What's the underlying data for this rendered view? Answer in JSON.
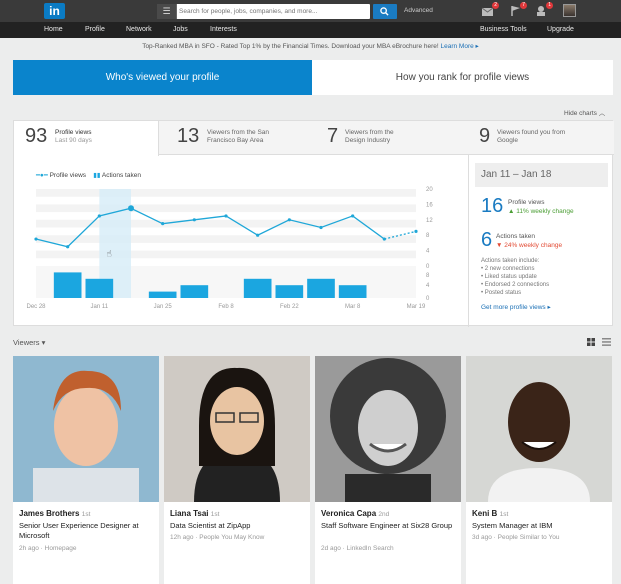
{
  "topbar": {
    "logo": "in",
    "search_placeholder": "Search for people, jobs, companies, and more...",
    "advanced": "Advanced",
    "badges": [
      "2",
      "7",
      "1"
    ]
  },
  "nav": [
    "Home",
    "Profile",
    "Network",
    "Jobs",
    "Interests",
    "Business Tools",
    "Upgrade"
  ],
  "promo": {
    "text": "Top-Ranked MBA in SFO - Rated Top 1% by the Financial Times. Download your MBA eBrochure here!",
    "link": "Learn More ▸"
  },
  "tabs": [
    "Who's viewed your profile",
    "How you rank for profile views"
  ],
  "hide_charts": "Hide charts",
  "stats": [
    {
      "num": "93",
      "label": "Profile views",
      "sub": "Last 90 days"
    },
    {
      "num": "13",
      "label": "Viewers from the San Francisco Bay Area"
    },
    {
      "num": "7",
      "label": "Viewers from the Design Industry"
    },
    {
      "num": "9",
      "label": "Viewers found you from Google"
    }
  ],
  "legend": {
    "views": "Profile views",
    "actions": "Actions taken"
  },
  "chart_data": {
    "type": "line",
    "x": [
      "Dec 28",
      "Jan 4",
      "Jan 11",
      "Jan 18",
      "Jan 25",
      "Feb 1",
      "Feb 8",
      "Feb 15",
      "Feb 22",
      "Mar 1",
      "Mar 8",
      "Mar 15",
      "Mar 19"
    ],
    "xticks": [
      "Dec 28",
      "Jan 11",
      "Jan 25",
      "Feb 8",
      "Feb 22",
      "Mar 8",
      "Mar 19"
    ],
    "series": [
      {
        "name": "Profile views",
        "values": [
          7,
          5,
          13,
          15,
          11,
          12,
          13,
          8,
          12,
          10,
          13,
          7,
          9
        ]
      },
      {
        "name": "Actions taken",
        "values": [
          0,
          4,
          3,
          0,
          1,
          2,
          0,
          3,
          2,
          3,
          2,
          0,
          0
        ]
      }
    ],
    "yticks": [
      "20",
      "16",
      "12",
      "8",
      "4",
      "0",
      "8",
      "4",
      "0"
    ],
    "ylim": [
      0,
      20
    ],
    "actions_ylim": [
      0,
      10
    ]
  },
  "side": {
    "range": "Jan 11 – Jan 18",
    "views_num": "16",
    "views_label": "Profile views",
    "views_change": "▲ 11% weekly change",
    "actions_num": "6",
    "actions_label": "Actions taken",
    "actions_change": "▼ 24% weekly change",
    "include_title": "Actions taken include:",
    "includes": [
      "• 2 new connections",
      "• Liked status update",
      "• Endorsed 2 connections",
      "• Posted status"
    ],
    "more": "Get more profile views ▸"
  },
  "viewers_label": "Viewers ▾",
  "cards": [
    {
      "name": "James Brothers",
      "degree": "1st",
      "title": "Senior User Experience Designer at Microsoft",
      "meta": "2h ago · Homepage"
    },
    {
      "name": "Liana Tsai",
      "degree": "1st",
      "title": "Data Scientist at ZipApp",
      "meta": "12h ago · People You May Know"
    },
    {
      "name": "Veronica Capa",
      "degree": "2nd",
      "title": "Staff Software Engineer at Six28 Group",
      "meta": "2d ago · LinkedIn Search"
    },
    {
      "name": "Keni B",
      "degree": "1st",
      "title": "System Manager at IBM",
      "meta": "3d ago · People Similar to You"
    }
  ],
  "colors": {
    "accent": "#0a84cc",
    "line": "#1fa7d8",
    "bar": "#1ba6e0",
    "topbar": "#3a3a3a"
  }
}
